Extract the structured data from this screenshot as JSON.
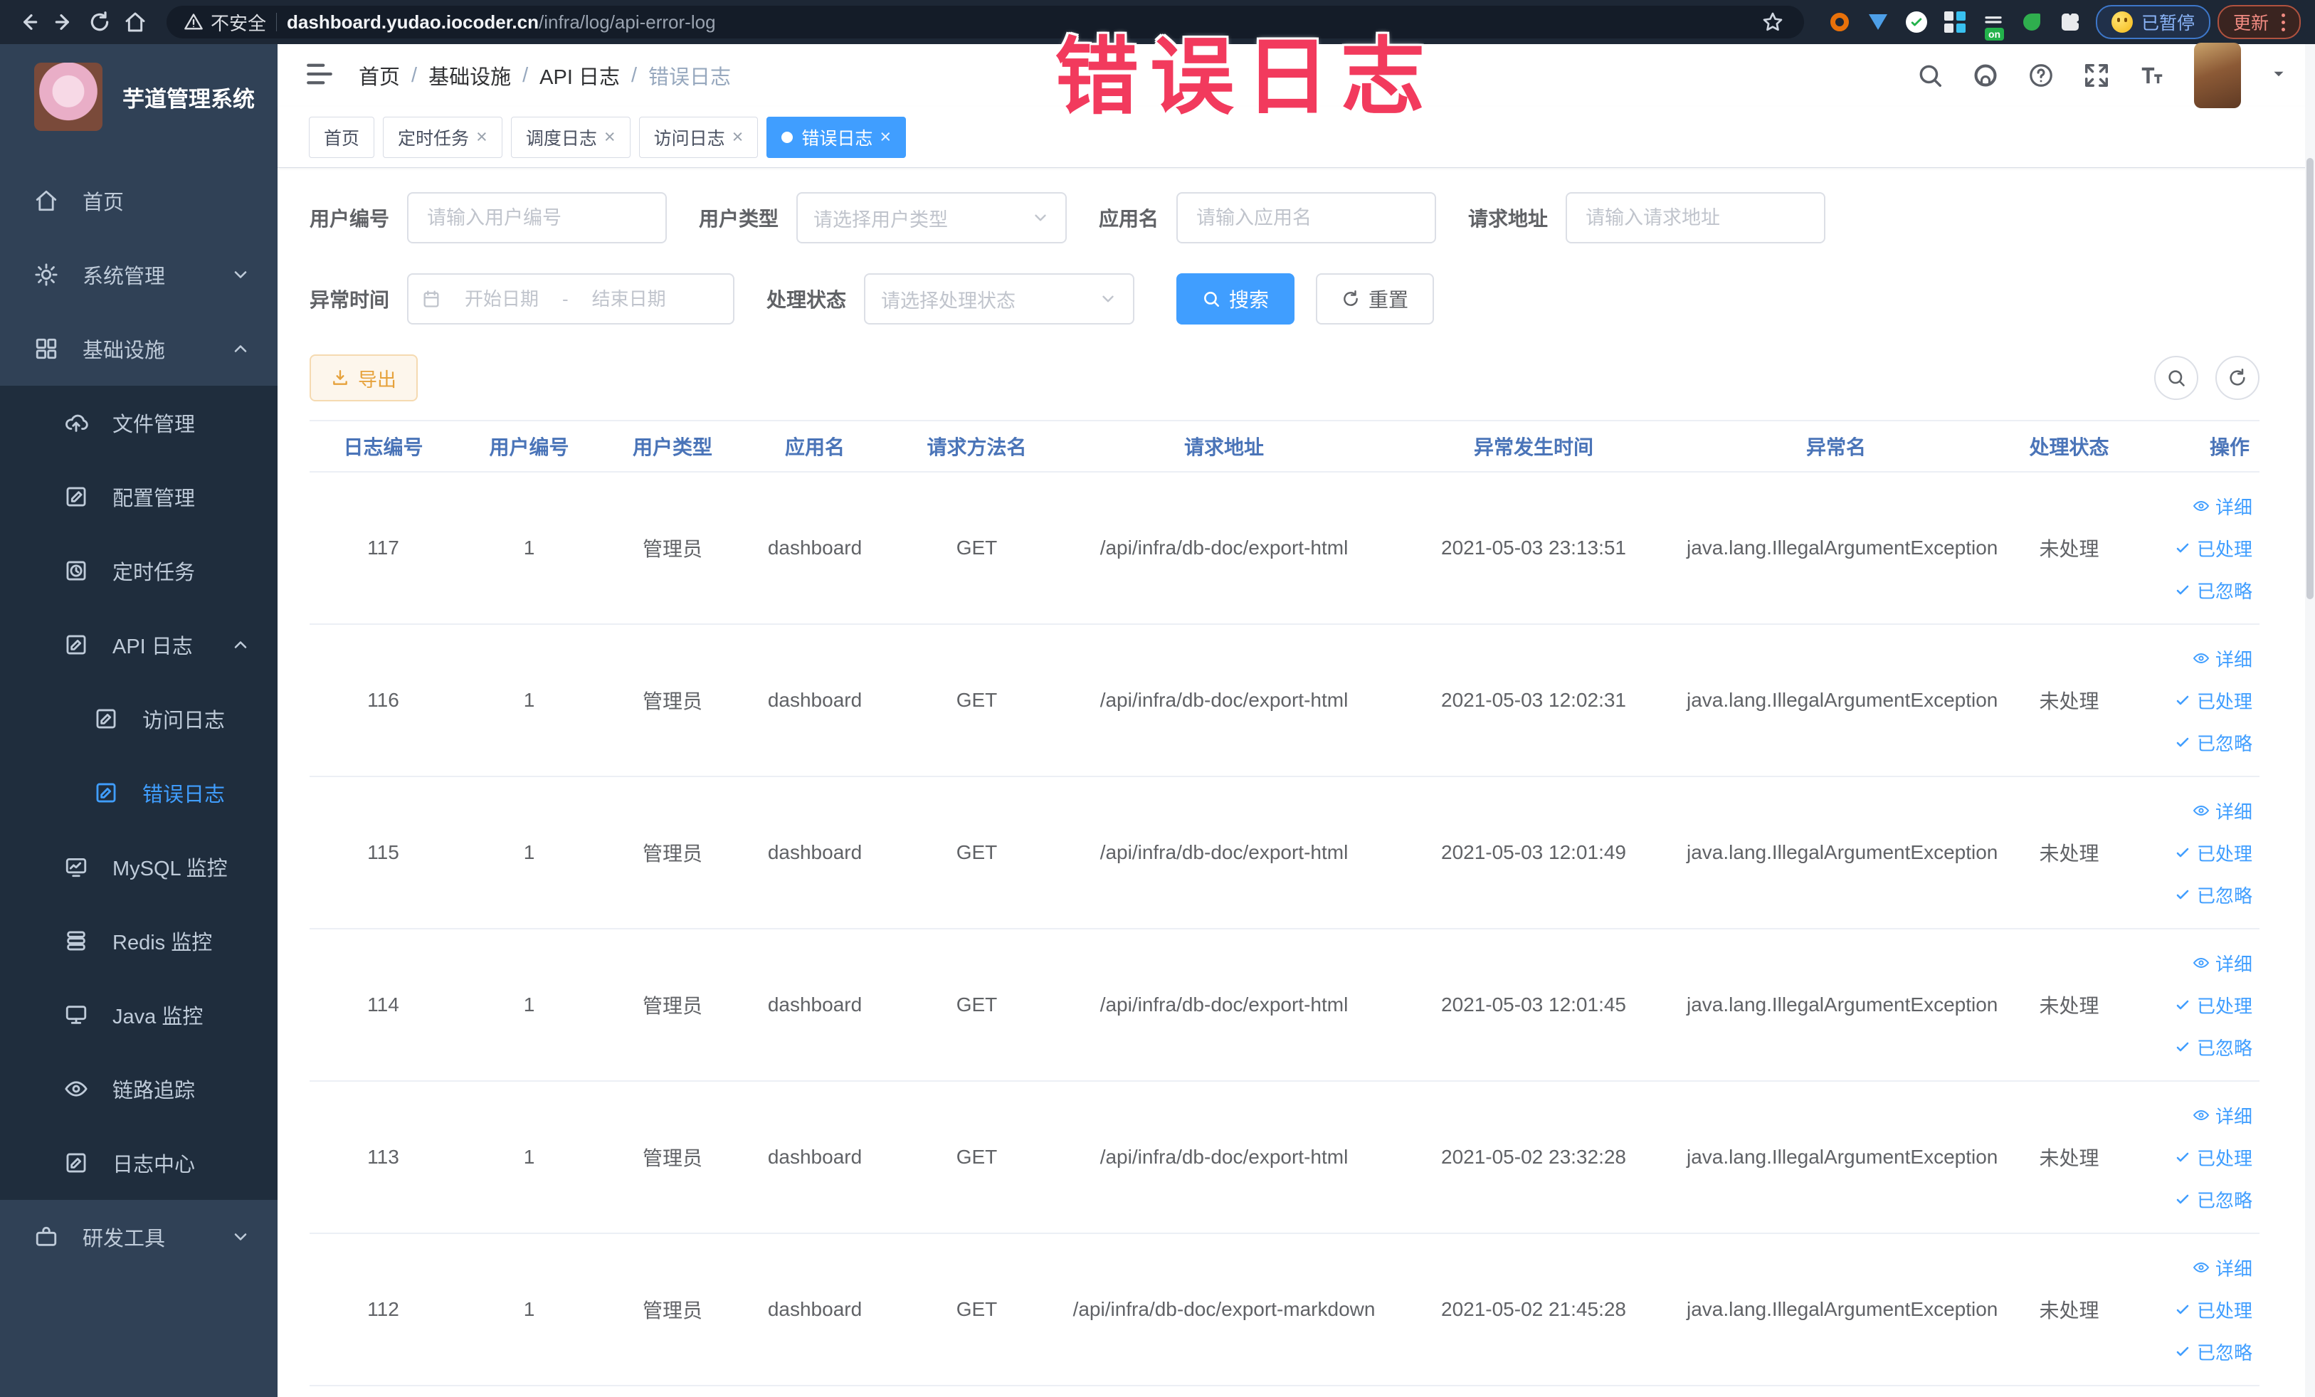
{
  "browser": {
    "security_label": "不安全",
    "url_host": "dashboard.yudao.iocoder.cn",
    "url_path": "/infra/log/api-error-log",
    "on_badge": "on",
    "paused_badge": "已暂停",
    "update_button": "更新"
  },
  "overlay": {
    "title": "错误日志",
    "color": "#f23a5d"
  },
  "sidebar": {
    "app_title": "芋道管理系统",
    "items": [
      {
        "label": "首页"
      },
      {
        "label": "系统管理"
      },
      {
        "label": "基础设施"
      },
      {
        "label": "文件管理"
      },
      {
        "label": "配置管理"
      },
      {
        "label": "定时任务"
      },
      {
        "label": "API 日志"
      },
      {
        "label": "访问日志"
      },
      {
        "label": "错误日志"
      },
      {
        "label": "MySQL 监控"
      },
      {
        "label": "Redis 监控"
      },
      {
        "label": "Java 监控"
      },
      {
        "label": "链路追踪"
      },
      {
        "label": "日志中心"
      },
      {
        "label": "研发工具"
      }
    ]
  },
  "breadcrumb": [
    "首页",
    "基础设施",
    "API 日志",
    "错误日志"
  ],
  "tabs": [
    {
      "label": "首页"
    },
    {
      "label": "定时任务"
    },
    {
      "label": "调度日志"
    },
    {
      "label": "访问日志"
    },
    {
      "label": "错误日志"
    }
  ],
  "filters": {
    "user_id": {
      "label": "用户编号",
      "placeholder": "请输入用户编号"
    },
    "user_type": {
      "label": "用户类型",
      "placeholder": "请选择用户类型"
    },
    "app_name": {
      "label": "应用名",
      "placeholder": "请输入应用名"
    },
    "request_url": {
      "label": "请求地址",
      "placeholder": "请输入请求地址"
    },
    "exception_time": {
      "label": "异常时间",
      "start_placeholder": "开始日期",
      "separator": "-",
      "end_placeholder": "结束日期"
    },
    "process_status": {
      "label": "处理状态",
      "placeholder": "请选择处理状态"
    },
    "search_button": "搜索",
    "reset_button": "重置"
  },
  "toolbar": {
    "export_button": "导出"
  },
  "colors": {
    "accent": "#409eff",
    "export_orange": "#e6a23c",
    "sidebar_bg": "#304156",
    "submenu_bg": "#1f2d3d",
    "overlay_red": "#f23a5d"
  },
  "table": {
    "columns": [
      "日志编号",
      "用户编号",
      "用户类型",
      "应用名",
      "请求方法名",
      "请求地址",
      "异常发生时间",
      "异常名",
      "处理状态",
      "操作"
    ],
    "actions": {
      "detail": "详细",
      "processed": "已处理",
      "ignored": "已忽略"
    },
    "rows": [
      {
        "id": "117",
        "user_id": "1",
        "user_type": "管理员",
        "app": "dashboard",
        "method": "GET",
        "url": "/api/infra/db-doc/export-html",
        "time": "2021-05-03 23:13:51",
        "exception": "java.lang.IllegalArgumentException",
        "status": "未处理"
      },
      {
        "id": "116",
        "user_id": "1",
        "user_type": "管理员",
        "app": "dashboard",
        "method": "GET",
        "url": "/api/infra/db-doc/export-html",
        "time": "2021-05-03 12:02:31",
        "exception": "java.lang.IllegalArgumentException",
        "status": "未处理"
      },
      {
        "id": "115",
        "user_id": "1",
        "user_type": "管理员",
        "app": "dashboard",
        "method": "GET",
        "url": "/api/infra/db-doc/export-html",
        "time": "2021-05-03 12:01:49",
        "exception": "java.lang.IllegalArgumentException",
        "status": "未处理"
      },
      {
        "id": "114",
        "user_id": "1",
        "user_type": "管理员",
        "app": "dashboard",
        "method": "GET",
        "url": "/api/infra/db-doc/export-html",
        "time": "2021-05-03 12:01:45",
        "exception": "java.lang.IllegalArgumentException",
        "status": "未处理"
      },
      {
        "id": "113",
        "user_id": "1",
        "user_type": "管理员",
        "app": "dashboard",
        "method": "GET",
        "url": "/api/infra/db-doc/export-html",
        "time": "2021-05-02 23:32:28",
        "exception": "java.lang.IllegalArgumentException",
        "status": "未处理"
      },
      {
        "id": "112",
        "user_id": "1",
        "user_type": "管理员",
        "app": "dashboard",
        "method": "GET",
        "url": "/api/infra/db-doc/export-markdown",
        "time": "2021-05-02 21:45:28",
        "exception": "java.lang.IllegalArgumentException",
        "status": "未处理"
      }
    ]
  }
}
